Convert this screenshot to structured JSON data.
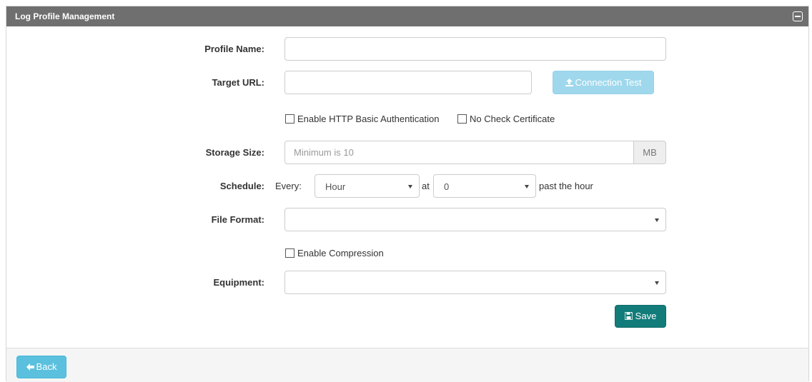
{
  "panel": {
    "title": "Log Profile Management",
    "collapse_icon": "minus-square-icon"
  },
  "form": {
    "profile_name": {
      "label": "Profile Name:",
      "value": ""
    },
    "target_url": {
      "label": "Target URL:",
      "value": ""
    },
    "connection_test": {
      "label": "Connection Test",
      "icon": "upload-icon"
    },
    "http_auth": {
      "label": "Enable HTTP Basic Authentication",
      "checked": false
    },
    "no_check_cert": {
      "label": "No Check Certificate",
      "checked": false
    },
    "storage_size": {
      "label": "Storage Size:",
      "placeholder": "Minimum is 10",
      "unit": "MB"
    },
    "schedule": {
      "label": "Schedule:",
      "every_text": "Every:",
      "interval": "Hour",
      "at_text": "at",
      "minute": "0",
      "suffix": "past the hour"
    },
    "file_format": {
      "label": "File Format:",
      "value": ""
    },
    "compression": {
      "label": "Enable Compression",
      "checked": false
    },
    "equipment": {
      "label": "Equipment:",
      "value": ""
    },
    "save": {
      "label": "Save",
      "icon": "floppy-disk-icon"
    }
  },
  "footer": {
    "back": {
      "label": "Back",
      "icon": "arrow-left-icon"
    }
  },
  "colors": {
    "header": "#6f6f6f",
    "info_button": "#5bc0de",
    "save_button": "#127c7a"
  }
}
